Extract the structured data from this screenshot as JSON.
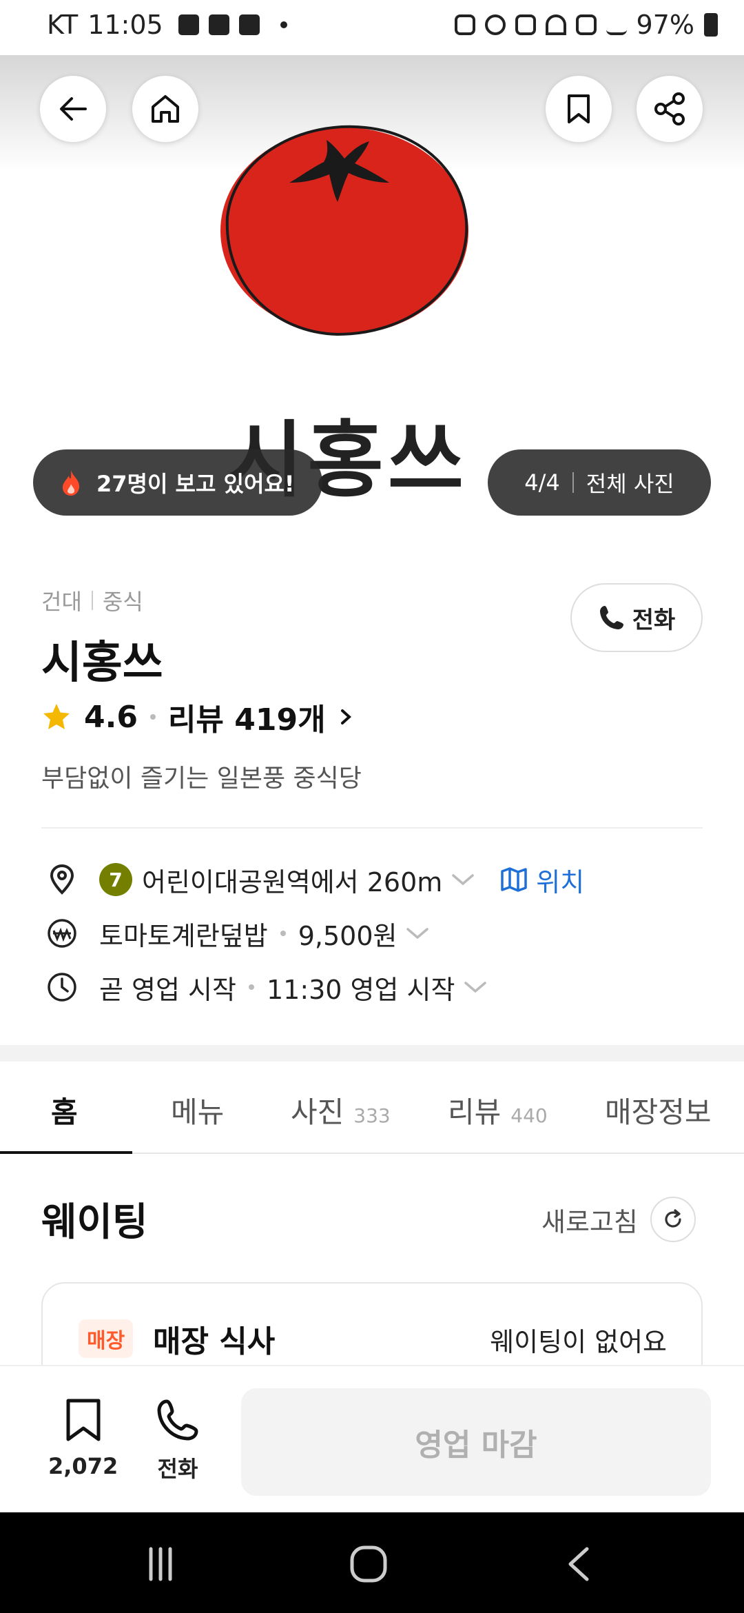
{
  "status_bar": {
    "carrier": "KT",
    "time": "11:05",
    "battery": "97%"
  },
  "hero": {
    "logo_text": "시홍쓰",
    "viewers_text": "27명이 보고 있어요!",
    "photo_counter": "4/4",
    "all_photos_label": "전체 사진",
    "logo_colors": {
      "tomato": "#d9241c",
      "stem": "#1a1a1a"
    }
  },
  "store": {
    "area": "건대",
    "category": "중식",
    "name": "시홍쓰",
    "rating": "4.6",
    "review_label": "리뷰 419개",
    "description": "부담없이 즐기는 일본풍 중식당",
    "call_label": "전화"
  },
  "details": {
    "subway_line": "7",
    "subway_line_color": "#747f00",
    "location_text": "어린이대공원역에서 260m",
    "map_link": "위치",
    "menu_item": "토마토계란덮밥",
    "menu_price": "9,500원",
    "hours_status": "곧 영업 시작",
    "hours_time": "11:30 영업 시작"
  },
  "tabs": [
    {
      "label": "홈",
      "count": ""
    },
    {
      "label": "메뉴",
      "count": ""
    },
    {
      "label": "사진",
      "count": "333"
    },
    {
      "label": "리뷰",
      "count": "440"
    },
    {
      "label": "매장정보",
      "count": ""
    }
  ],
  "waiting": {
    "title": "웨이팅",
    "refresh_label": "새로고침",
    "badge": "매장",
    "type": "매장 식사",
    "status": "웨이팅이 없어요"
  },
  "action_bar": {
    "save_count": "2,072",
    "call_label": "전화",
    "closed_label": "영업 마감"
  },
  "colors": {
    "accent_blue": "#1f6fd8",
    "badge_orange": "#ff5a2b",
    "star": "#f5b800"
  }
}
